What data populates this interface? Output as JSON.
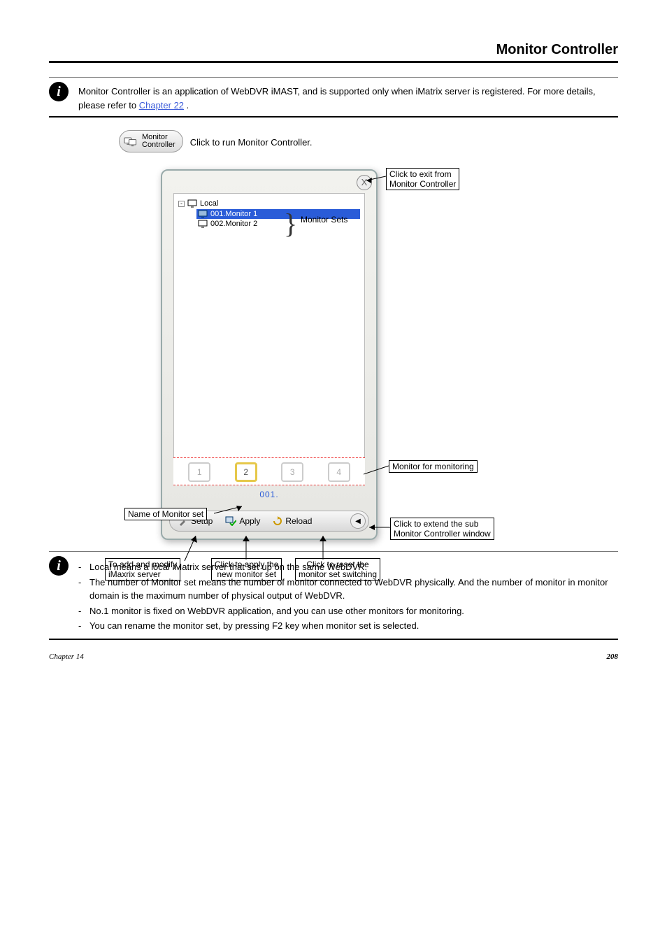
{
  "page": {
    "title": "Monitor Controller"
  },
  "noteTop": {
    "prefix": "Monitor Controller is an application of WebDVR iMAST, and is supported only when iMatrix server is registered. For more details, please refer to ",
    "link_text": "Chapter 22",
    "suffix": "."
  },
  "launch": {
    "button_label": "Monitor\nController",
    "click_text": "Click to run Monitor Controller."
  },
  "mc": {
    "close_title": "X",
    "tree": {
      "root": "Local",
      "items": [
        "001.Monitor 1",
        "002.Monitor 2"
      ]
    },
    "monstrip": {
      "slots": [
        "1",
        "2",
        "3",
        "4"
      ],
      "active_index": 1
    },
    "setname": "001.",
    "toolbar": {
      "setup": "Setup",
      "apply": "Apply",
      "reload": "Reload",
      "arrow_glyph": "◀"
    }
  },
  "labels": {
    "monitor_sets": "Monitor Sets",
    "exit": "Click to exit from\nMonitor Controller",
    "monitoring": "Monitor for monitoring",
    "setname": "Name of Monitor set",
    "extend": "Click to extend the sub\nMonitor Controller window",
    "setup_note": "To add and modify\niMaxrix server",
    "apply_note": "Click to apply the\nnew monitor set",
    "reload_note": "Click to reset the\nmonitor set switching"
  },
  "notesBottom": [
    "Local means a local iMatrix server that set up on the same WebDVR.",
    "The number of Monitor set means the number of monitor connected to WebDVR physically. And the number of monitor in monitor domain is the maximum number of physical output of WebDVR.",
    "No.1 monitor is fixed on WebDVR application, and you can use other monitors for monitoring.",
    "You can rename the monitor set, by pressing F2 key when monitor set is selected."
  ],
  "footer": {
    "chapter": "Chapter 14",
    "page": "208"
  }
}
